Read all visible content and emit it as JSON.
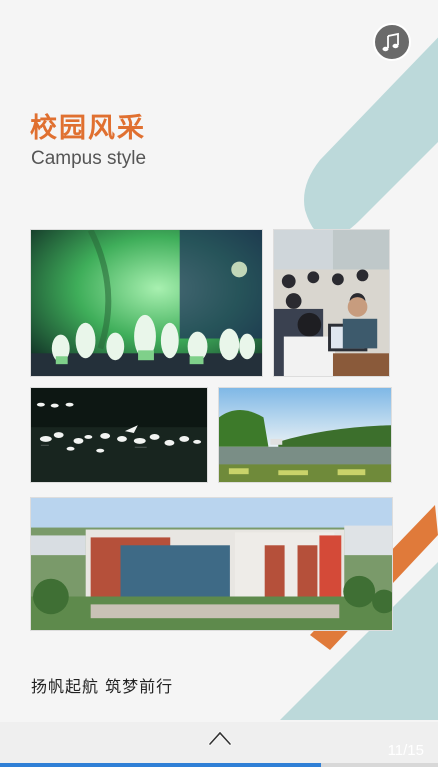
{
  "header": {
    "title": "校园风采",
    "subtitle": "Campus style"
  },
  "music_icon": "music-note-icon",
  "footer": {
    "slogan": "扬帆起航  筑梦前行",
    "page_counter": "11/15",
    "page_current": 11,
    "page_total": 15
  },
  "colors": {
    "title_orange": "#e07030",
    "stripe_teal": "#bcd9da",
    "stripe_orange": "#e07a3a",
    "progress_blue": "#2f7fd6"
  }
}
